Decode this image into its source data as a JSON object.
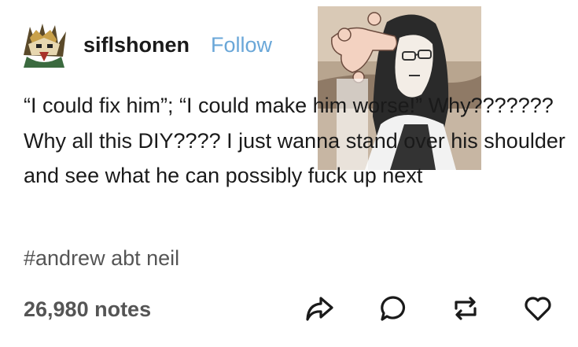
{
  "post": {
    "username": "siflshonen",
    "follow_label": "Follow",
    "body": "“I could fix him”; “I could make him worse!” Why??????? Why all this DIY???? I just wanna stand over his shoulder and see what he can possibly fuck up next",
    "tag": "#andrew abt neil",
    "notes": "26,980 notes"
  },
  "icons": {
    "avatar": "avatar-image",
    "reaction": "anime-reaction-image",
    "share": "share-arrow-icon",
    "reply": "reply-bubble-icon",
    "reblog": "reblog-icon",
    "like": "heart-icon"
  },
  "colors": {
    "follow": "#6aa7d8",
    "text": "#1a1a1a",
    "muted": "#555555"
  }
}
